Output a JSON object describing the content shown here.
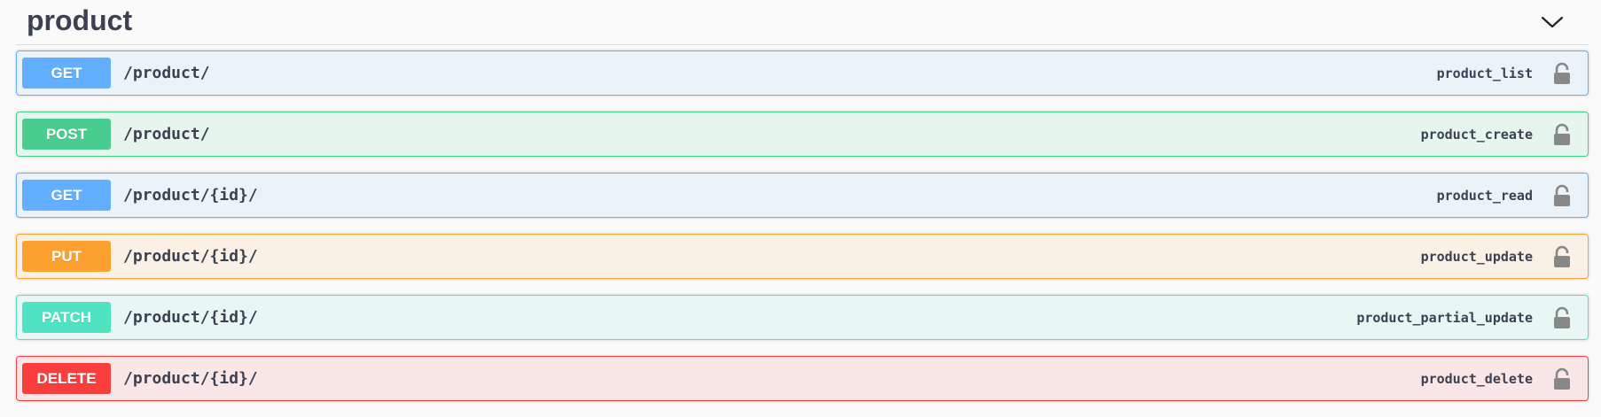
{
  "tag": {
    "title": "product",
    "toggle_icon": "chevron-down-icon"
  },
  "operations": [
    {
      "method": "GET",
      "path": "/product/",
      "summary": "product_list",
      "icon": "lock-icon",
      "color": "#61affe"
    },
    {
      "method": "POST",
      "path": "/product/",
      "summary": "product_create",
      "icon": "lock-icon",
      "color": "#49cc90"
    },
    {
      "method": "GET",
      "path": "/product/{id}/",
      "summary": "product_read",
      "icon": "lock-icon",
      "color": "#61affe"
    },
    {
      "method": "PUT",
      "path": "/product/{id}/",
      "summary": "product_update",
      "icon": "lock-icon",
      "color": "#fca130"
    },
    {
      "method": "PATCH",
      "path": "/product/{id}/",
      "summary": "product_partial_update",
      "icon": "lock-icon",
      "color": "#50e3c2"
    },
    {
      "method": "DELETE",
      "path": "/product/{id}/",
      "summary": "product_delete",
      "icon": "lock-icon",
      "color": "#f93e3e"
    }
  ]
}
